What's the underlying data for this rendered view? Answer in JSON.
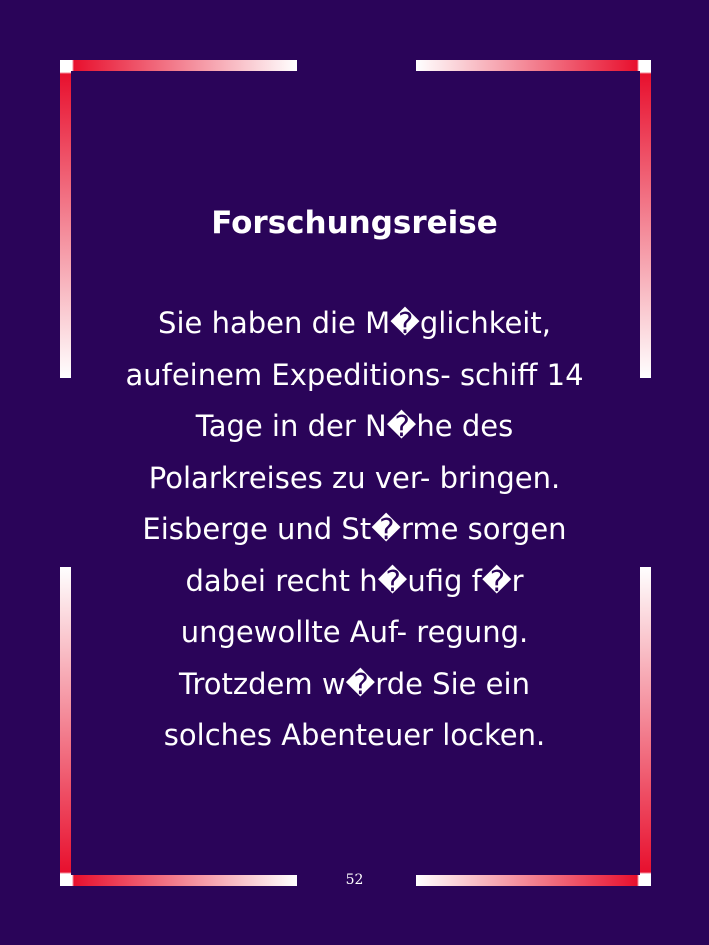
{
  "page": {
    "background_color": "#2a0459",
    "frame_accent_color": "#e8102e",
    "frame_light_color": "#ffffff"
  },
  "title": "Forschungsreise",
  "body_lines": [
    "Sie haben die M�glichkeit,",
    "aufeinem Expeditions- schiff 14",
    "Tage in der N�he des",
    "Polarkreises zu ver- bringen.",
    "Eisberge und St�rme sorgen",
    "dabei recht h�ufig f�r",
    "ungewollte Auf- regung.",
    "Trotzdem w�rde Sie ein",
    "solches Abenteuer locken."
  ],
  "page_number": "52"
}
